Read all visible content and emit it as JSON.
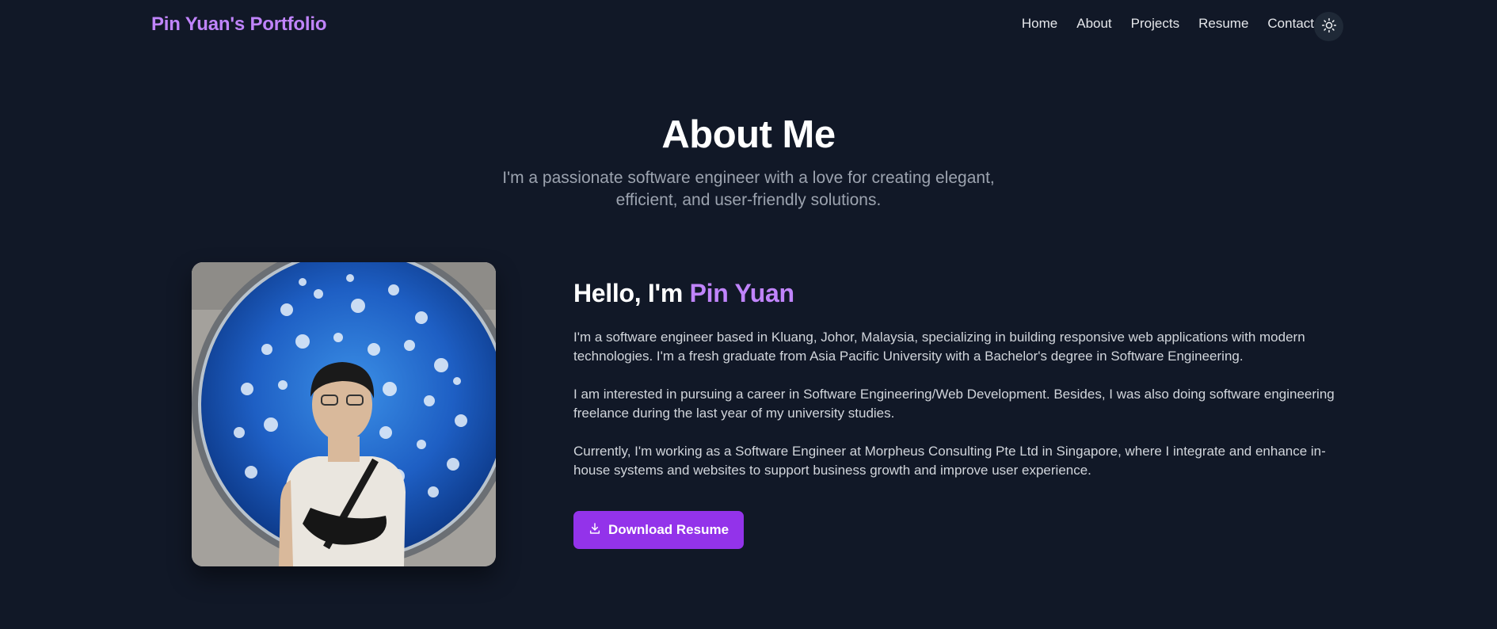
{
  "nav": {
    "brand": "Pin Yuan's Portfolio",
    "links": [
      "Home",
      "About",
      "Projects",
      "Resume",
      "Contact"
    ],
    "theme_icon": "sun-icon"
  },
  "hero": {
    "title": "About Me",
    "subtitle": "I'm a passionate software engineer with a love for creating elegant, efficient, and user-friendly solutions."
  },
  "profile": {
    "greeting_prefix": "Hello, I'm ",
    "name": "Pin Yuan",
    "paragraphs": [
      "I'm a software engineer based in Kluang, Johor, Malaysia, specializing in building responsive web applications with modern technologies. I'm a fresh graduate from Asia Pacific University with a Bachelor's degree in Software Engineering.",
      "I am interested in pursuing a career in Software Engineering/Web Development. Besides, I was also doing software engineering freelance during the last year of my university studies.",
      "Currently, I'm working as a Software Engineer at Morpheus Consulting Pte Ltd in Singapore, where I integrate and enhance in-house systems and websites to support business growth and improve user experience."
    ],
    "download_label": "Download Resume",
    "download_icon": "download-icon"
  },
  "colors": {
    "background": "#111827",
    "accent": "#c084fc",
    "button": "#9333ea",
    "muted_text": "#9ca3af",
    "body_text": "#d1d5db"
  }
}
